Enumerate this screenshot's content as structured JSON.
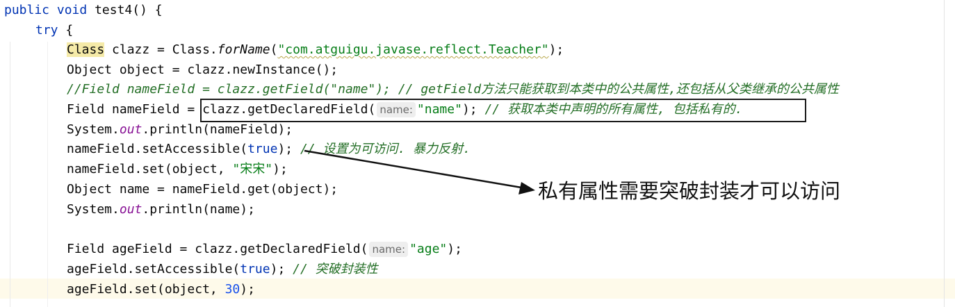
{
  "code": {
    "l1": {
      "t1": "public",
      "t2": " ",
      "t3": "void",
      "t4": " test4() {"
    },
    "l2": {
      "t1": "try",
      "t2": " {"
    },
    "l3": {
      "t1": "Class",
      "t2": " clazz = Class.",
      "t3": "forName",
      "t4": "(",
      "t5": "\"com.atguigu.javase.reflect.Teacher\"",
      "t6": ");"
    },
    "l4": {
      "t1": "Object object = clazz.newInstance();"
    },
    "l5": {
      "t1": "//Field nameField = clazz.getField(\"name\"); // getField方法只能获取到本类中的公共属性,还包括从父类继承的公共属性"
    },
    "l6": {
      "t1": "Field nameField = ",
      "t2": "clazz.getDeclaredField(",
      "hint": "name:",
      "t3": "\"name\"",
      "t4": "); ",
      "t5": "// 获取本类中声明的所有属性, 包括私有的."
    },
    "l7": {
      "t1": "System.",
      "t2": "out",
      "t3": ".println(nameField);"
    },
    "l8": {
      "t1": "nameField.setAccessible(",
      "t2": "true",
      "t3": "); ",
      "t4": "// 设置为可访问. 暴力反射."
    },
    "l9": {
      "t1": "nameField.set(object, ",
      "t2": "\"宋宋\"",
      "t3": ");"
    },
    "l10": {
      "t1": "Object name = nameField.get(object);"
    },
    "l11": {
      "t1": "System.",
      "t2": "out",
      "t3": ".println(name);"
    },
    "l12": {
      "t1": "Field ageField = clazz.getDeclaredField(",
      "hint": "name:",
      "t2": "\"age\"",
      "t3": ");"
    },
    "l13": {
      "t1": "ageField.setAccessible(",
      "t2": "true",
      "t3": "); ",
      "t4": "// 突破封装性"
    },
    "l14": {
      "t1": "ageField.set(object, ",
      "t2": "30",
      "t3": ");"
    }
  },
  "annotation": {
    "callout_text": "私有属性需要突破封装才可以访问"
  },
  "colors": {
    "keyword": "#0033b3",
    "string": "#067d17",
    "number": "#1750eb",
    "static_field": "#871094",
    "comment": "#8c8c8c",
    "comment_green": "#236e25",
    "class_highlight": "#f5eaa8",
    "current_line": "#fefaea"
  }
}
